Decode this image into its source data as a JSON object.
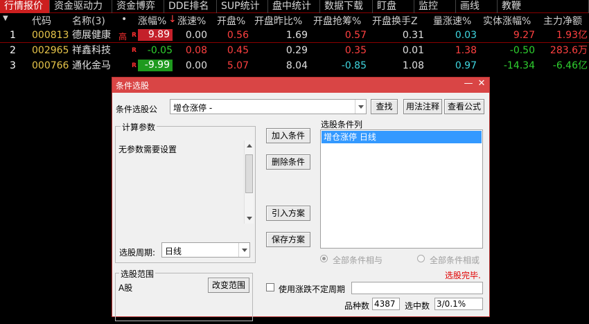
{
  "menu": {
    "items": [
      "行情报价",
      "资金驱动力",
      "资金博弈",
      "DDE排名",
      "SUP统计",
      "盘中统计",
      "数据下载",
      "盯盘",
      "监控",
      "画线",
      "教鞭"
    ]
  },
  "table": {
    "headers": {
      "code": "代码",
      "name": "名称(3)",
      "dot": "•",
      "pct": "涨幅%",
      "sort_mark": "↓",
      "speed": "涨速%",
      "open_pct": "开盘%",
      "open_ratio": "开盘昨比%",
      "open_grab": "开盘抢筹%",
      "open_turnover": "开盘换手Z",
      "vol_speed": "量涨速%",
      "body_pct": "实体涨幅%",
      "main_net": "主力净额"
    },
    "rows": [
      {
        "idx": "1",
        "code": "000813",
        "name": "德展健康",
        "tag": "R",
        "flag": "高",
        "pct": "9.89",
        "speed": "0.00",
        "open_pct": "0.56",
        "open_ratio": "1.69",
        "open_grab": "0.57",
        "open_turnover": "0.31",
        "vol_speed": "0.03",
        "body_pct": "9.27",
        "main_net": "1.93亿"
      },
      {
        "idx": "2",
        "code": "002965",
        "name": "祥鑫科技",
        "tag": "R",
        "flag": "",
        "pct": "-0.05",
        "speed": "0.08",
        "open_pct": "0.45",
        "open_ratio": "0.29",
        "open_grab": "0.35",
        "open_turnover": "0.01",
        "vol_speed": "1.38",
        "body_pct": "-0.50",
        "main_net": "283.6万"
      },
      {
        "idx": "3",
        "code": "000766",
        "name": "通化金马",
        "tag": "R",
        "flag": "",
        "pct": "-9.99",
        "speed": "0.00",
        "open_pct": "5.07",
        "open_ratio": "8.04",
        "open_grab": "-0.85",
        "open_turnover": "1.08",
        "vol_speed": "0.97",
        "body_pct": "-14.34",
        "main_net": "-6.46亿"
      }
    ]
  },
  "dialog": {
    "title": "条件选股",
    "minimize": "—",
    "close": "✕",
    "formula_label": "条件选股公",
    "formula_value": "增仓涨停  -",
    "find_btn": "查找",
    "usage_btn": "用法注释",
    "view_btn": "查看公式",
    "params_title": "计算参数",
    "params_text": "无参数需要设置",
    "period_label": "选股周期:",
    "period_value": "日线",
    "add_btn": "加入条件",
    "delete_btn": "删除条件",
    "import_btn": "引入方案",
    "save_btn": "保存方案",
    "conditions_title": "选股条件列",
    "conditions": [
      "增仓涨停  日线"
    ],
    "all_and": "全部条件相与",
    "all_or": "全部条件相或",
    "status": "选股完毕.",
    "range_title": "选股范围",
    "range_value": "A股",
    "range_btn": "改变范围",
    "irregular_label": "使用涨跌不定周期",
    "count_label": "品种数",
    "count_value": "4387",
    "selected_label": "选中数",
    "selected_value": "3/0.1%"
  },
  "colors": {
    "accent_red": "#cc1f1f",
    "up": "#ff4040",
    "down": "#2fd12f",
    "title_bar": "#d94545",
    "selection": "#3399ff"
  }
}
